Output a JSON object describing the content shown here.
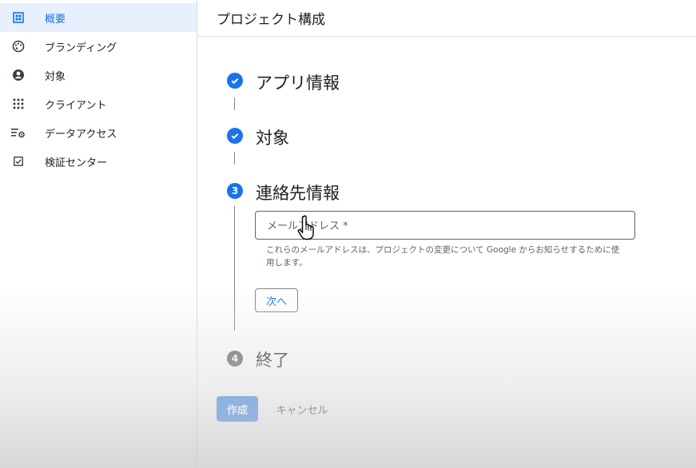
{
  "sidebar": {
    "items": [
      {
        "label": "概要",
        "icon": "dashboard-icon",
        "active": true
      },
      {
        "label": "ブランディング",
        "icon": "palette-icon",
        "active": false
      },
      {
        "label": "対象",
        "icon": "account-circle-icon",
        "active": false
      },
      {
        "label": "クライアント",
        "icon": "apps-grid-icon",
        "active": false
      },
      {
        "label": "データアクセス",
        "icon": "data-settings-icon",
        "active": false
      },
      {
        "label": "検証センター",
        "icon": "checkbox-icon",
        "active": false
      }
    ]
  },
  "header": {
    "title": "プロジェクト構成"
  },
  "stepper": {
    "steps": [
      {
        "label": "アプリ情報",
        "state": "done"
      },
      {
        "label": "対象",
        "state": "done"
      },
      {
        "label": "連絡先情報",
        "state": "current",
        "number": "3"
      },
      {
        "label": "終了",
        "state": "future",
        "number": "4"
      }
    ]
  },
  "contact": {
    "email_placeholder": "メールアドレス *",
    "email_value": "",
    "hint": "これらのメールアドレスは、プロジェクトの変更について Google からお知らせするために使用します。",
    "next_label": "次へ"
  },
  "actions": {
    "create_label": "作成",
    "cancel_label": "キャンセル"
  },
  "colors": {
    "accent": "#1a73e8",
    "active_bg": "#e8f0fe",
    "future_step": "#5f6368"
  }
}
